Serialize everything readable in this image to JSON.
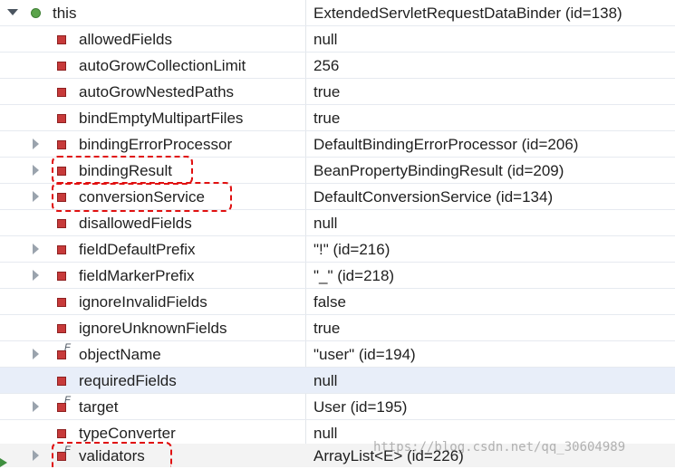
{
  "variables": [
    {
      "name": "this",
      "value": "ExtendedServletRequestDataBinder  (id=138)",
      "icon": "object-icon",
      "expandable": true,
      "expanded": true
    },
    {
      "name": "allowedFields",
      "value": "null",
      "icon": "private-field-icon",
      "expandable": false
    },
    {
      "name": "autoGrowCollectionLimit",
      "value": "256",
      "icon": "private-field-icon",
      "expandable": false
    },
    {
      "name": "autoGrowNestedPaths",
      "value": "true",
      "icon": "private-field-icon",
      "expandable": false
    },
    {
      "name": "bindEmptyMultipartFiles",
      "value": "true",
      "icon": "private-field-icon",
      "expandable": false
    },
    {
      "name": "bindingErrorProcessor",
      "value": "DefaultBindingErrorProcessor  (id=206)",
      "icon": "private-field-icon",
      "expandable": true
    },
    {
      "name": "bindingResult",
      "value": "BeanPropertyBindingResult  (id=209)",
      "icon": "private-field-icon",
      "expandable": true
    },
    {
      "name": "conversionService",
      "value": "DefaultConversionService  (id=134)",
      "icon": "private-field-icon",
      "expandable": true
    },
    {
      "name": "disallowedFields",
      "value": "null",
      "icon": "private-field-icon",
      "expandable": false
    },
    {
      "name": "fieldDefaultPrefix",
      "value": "\"!\" (id=216)",
      "icon": "private-field-icon",
      "expandable": true
    },
    {
      "name": "fieldMarkerPrefix",
      "value": "\"_\" (id=218)",
      "icon": "private-field-icon",
      "expandable": true
    },
    {
      "name": "ignoreInvalidFields",
      "value": "false",
      "icon": "private-field-icon",
      "expandable": false
    },
    {
      "name": "ignoreUnknownFields",
      "value": "true",
      "icon": "private-field-icon",
      "expandable": false
    },
    {
      "name": "objectName",
      "value": "\"user\" (id=194)",
      "icon": "private-final-field-icon",
      "expandable": true
    },
    {
      "name": "requiredFields",
      "value": "null",
      "icon": "private-field-icon",
      "expandable": false
    },
    {
      "name": "target",
      "value": "User  (id=195)",
      "icon": "private-final-field-icon",
      "expandable": true
    },
    {
      "name": "typeConverter",
      "value": "null",
      "icon": "private-field-icon",
      "expandable": false
    },
    {
      "name": "validators",
      "value": "ArrayList<E>  (id=226)",
      "icon": "private-final-field-icon",
      "expandable": true
    }
  ],
  "watermark": "https://blog.csdn.net/qq_30604989",
  "colors": {
    "highlight": "#e01010",
    "field_icon": "#c73a3a",
    "object_icon": "#5aa34a"
  }
}
